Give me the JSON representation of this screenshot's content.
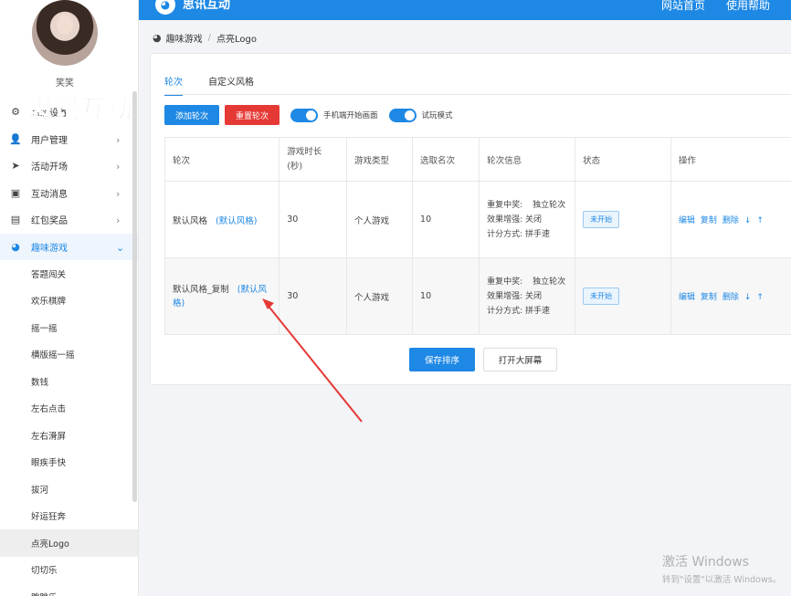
{
  "header": {
    "title": "思讯互动",
    "nav": [
      "网站首页",
      "使用帮助"
    ]
  },
  "user": {
    "name": "笑笑"
  },
  "watermark": "思讯互动",
  "sidebar": {
    "items": [
      {
        "label": "系统设置",
        "icon": "gear-icon"
      },
      {
        "label": "用户管理",
        "icon": "user-icon"
      },
      {
        "label": "活动开场",
        "icon": "send-icon"
      },
      {
        "label": "互动消息",
        "icon": "message-icon"
      },
      {
        "label": "红包奖品",
        "icon": "gift-icon"
      },
      {
        "label": "趣味游戏",
        "icon": "game-icon",
        "active": true
      }
    ],
    "sub_items": [
      "答题闯关",
      "欢乐棋牌",
      "摇一摇",
      "横版摇一摇",
      "数钱",
      "左右点击",
      "左右滑屏",
      "眼疾手快",
      "拔河",
      "好运狂奔",
      "点亮Logo",
      "切切乐",
      "跳跳乐"
    ],
    "selected_sub": "点亮Logo"
  },
  "breadcrumb": {
    "parent": "趣味游戏",
    "current": "点亮Logo"
  },
  "tabs": [
    "轮次",
    "自定义风格"
  ],
  "toolbar": {
    "add_round": "添加轮次",
    "reset_round": "重置轮次",
    "toggle1": "手机端开始画面",
    "toggle2": "试玩模式"
  },
  "table": {
    "headers": [
      "轮次",
      "游戏时长(秒)",
      "游戏类型",
      "选取名次",
      "轮次信息",
      "状态",
      "操作"
    ],
    "rows": [
      {
        "name": "默认风格",
        "style": "(默认风格)",
        "duration": "30",
        "type": "个人游戏",
        "rank": "10",
        "info": {
          "l1a": "重复中奖:",
          "l1b": "独立轮次",
          "l2": "效果增强: 关闭",
          "l3": "计分方式: 拼手速"
        },
        "status": "未开始",
        "ops": [
          "编辑",
          "复制",
          "删除",
          "↓",
          "↑"
        ]
      },
      {
        "name": "默认风格_复制",
        "style": "(默认风格)",
        "duration": "30",
        "type": "个人游戏",
        "rank": "10",
        "info": {
          "l1a": "重复中奖:",
          "l1b": "独立轮次",
          "l2": "效果增强: 关闭",
          "l3": "计分方式: 拼手速"
        },
        "status": "未开始",
        "ops": [
          "编辑",
          "复制",
          "删除",
          "↓",
          "↑"
        ]
      }
    ]
  },
  "buttons": {
    "save_sort": "保存排序",
    "open_screen": "打开大屏幕"
  },
  "windows_activation": {
    "line1": "激活 Windows",
    "line2": "转到\"设置\"以激活 Windows。"
  },
  "colors": {
    "primary": "#1e88e5",
    "danger": "#e53935"
  }
}
